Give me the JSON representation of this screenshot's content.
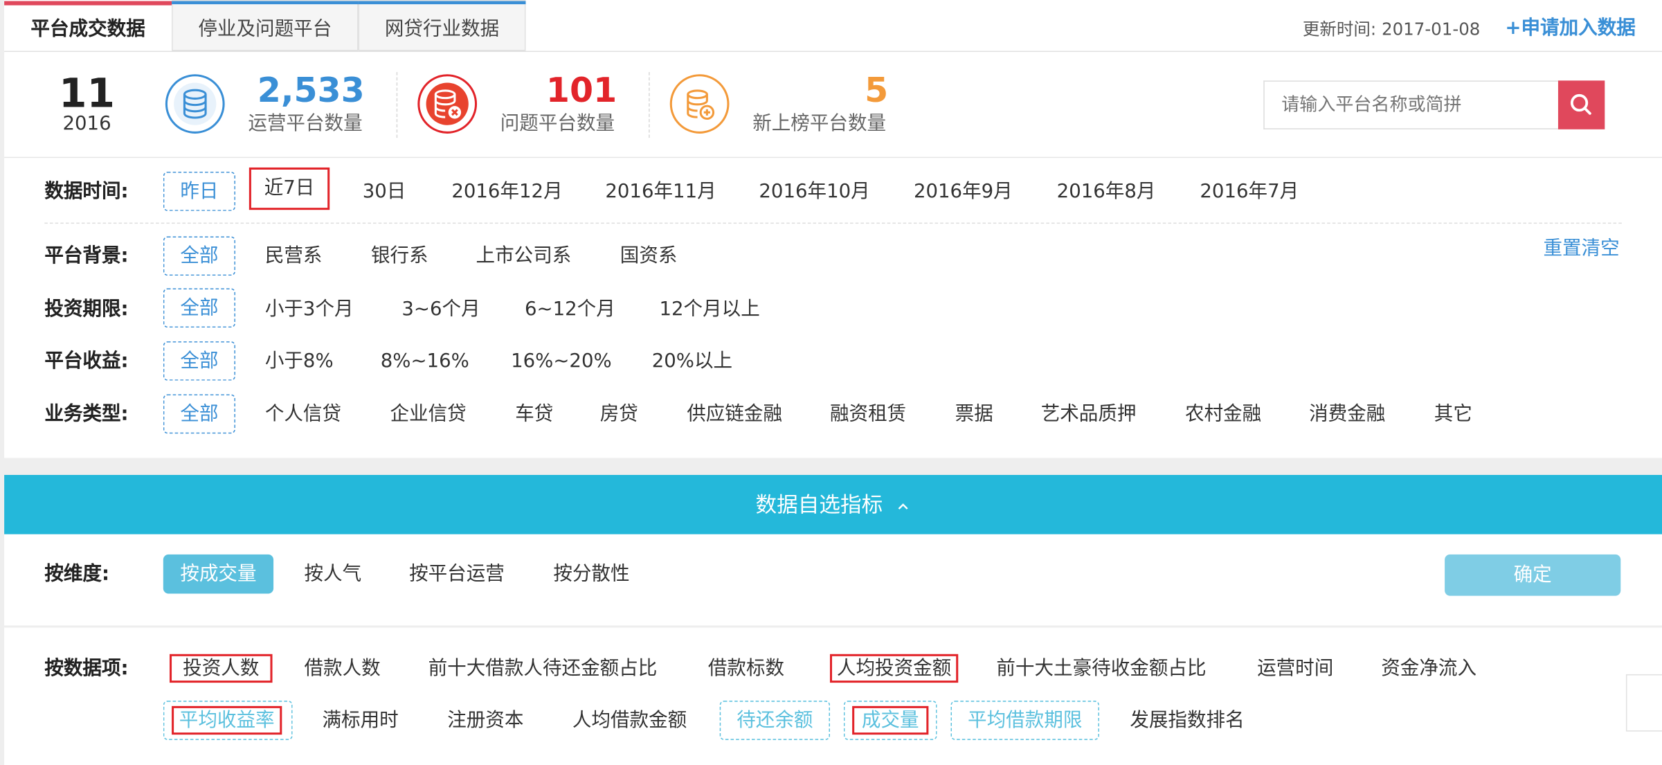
{
  "tabs": [
    {
      "label": "平台成交数据"
    },
    {
      "label": "停业及问题平台"
    },
    {
      "label": "网贷行业数据"
    }
  ],
  "header": {
    "update_label": "更新时间:",
    "update_date": "2017-01-08",
    "join_label": "+申请加入数据"
  },
  "date_badge": {
    "day": "11",
    "year": "2016"
  },
  "stats": [
    {
      "value": "2,533",
      "label": "运营平台数量",
      "color": "#3a8fd6",
      "icon": "database-icon"
    },
    {
      "value": "101",
      "label": "问题平台数量",
      "color": "#e2242a",
      "icon": "database-error-icon"
    },
    {
      "value": "5",
      "label": "新上榜平台数量",
      "color": "#f39a3a",
      "icon": "database-add-icon"
    }
  ],
  "search": {
    "placeholder": "请输入平台名称或简拼",
    "button_color": "#e0485c"
  },
  "filters": {
    "reset_label": "重置清空",
    "time": {
      "label": "数据时间:",
      "options": [
        "昨日",
        "近7日",
        "30日",
        "2016年12月",
        "2016年11月",
        "2016年10月",
        "2016年9月",
        "2016年8月",
        "2016年7月"
      ]
    },
    "background": {
      "label": "平台背景:",
      "options": [
        "全部",
        "民营系",
        "银行系",
        "上市公司系",
        "国资系"
      ]
    },
    "term": {
      "label": "投资期限:",
      "options": [
        "全部",
        "小于3个月",
        "3~6个月",
        "6~12个月",
        "12个月以上"
      ]
    },
    "yield": {
      "label": "平台收益:",
      "options": [
        "全部",
        "小于8%",
        "8%~16%",
        "16%~20%",
        "20%以上"
      ]
    },
    "business": {
      "label": "业务类型:",
      "options": [
        "全部",
        "个人信贷",
        "企业信贷",
        "车贷",
        "房贷",
        "供应链金融",
        "融资租赁",
        "票据",
        "艺术品质押",
        "农村金融",
        "消费金融",
        "其它"
      ]
    }
  },
  "metrics_bar": {
    "title": "数据自选指标",
    "arrow": "chevron-up-icon",
    "color": "#24b8da"
  },
  "dimension": {
    "label": "按维度:",
    "options": [
      "按成交量",
      "按人气",
      "按平台运营",
      "按分散性"
    ],
    "confirm_label": "确定"
  },
  "data_items": {
    "label": "按数据项:",
    "row1": [
      "投资人数",
      "借款人数",
      "前十大借款人待还金额占比",
      "借款标数",
      "人均投资金额",
      "前十大土豪待收金额占比",
      "运营时间",
      "资金净流入"
    ],
    "row2": [
      "平均收益率",
      "满标用时",
      "注册资本",
      "人均借款金额",
      "待还余额",
      "成交量",
      "平均借款期限",
      "发展指数排名"
    ]
  }
}
